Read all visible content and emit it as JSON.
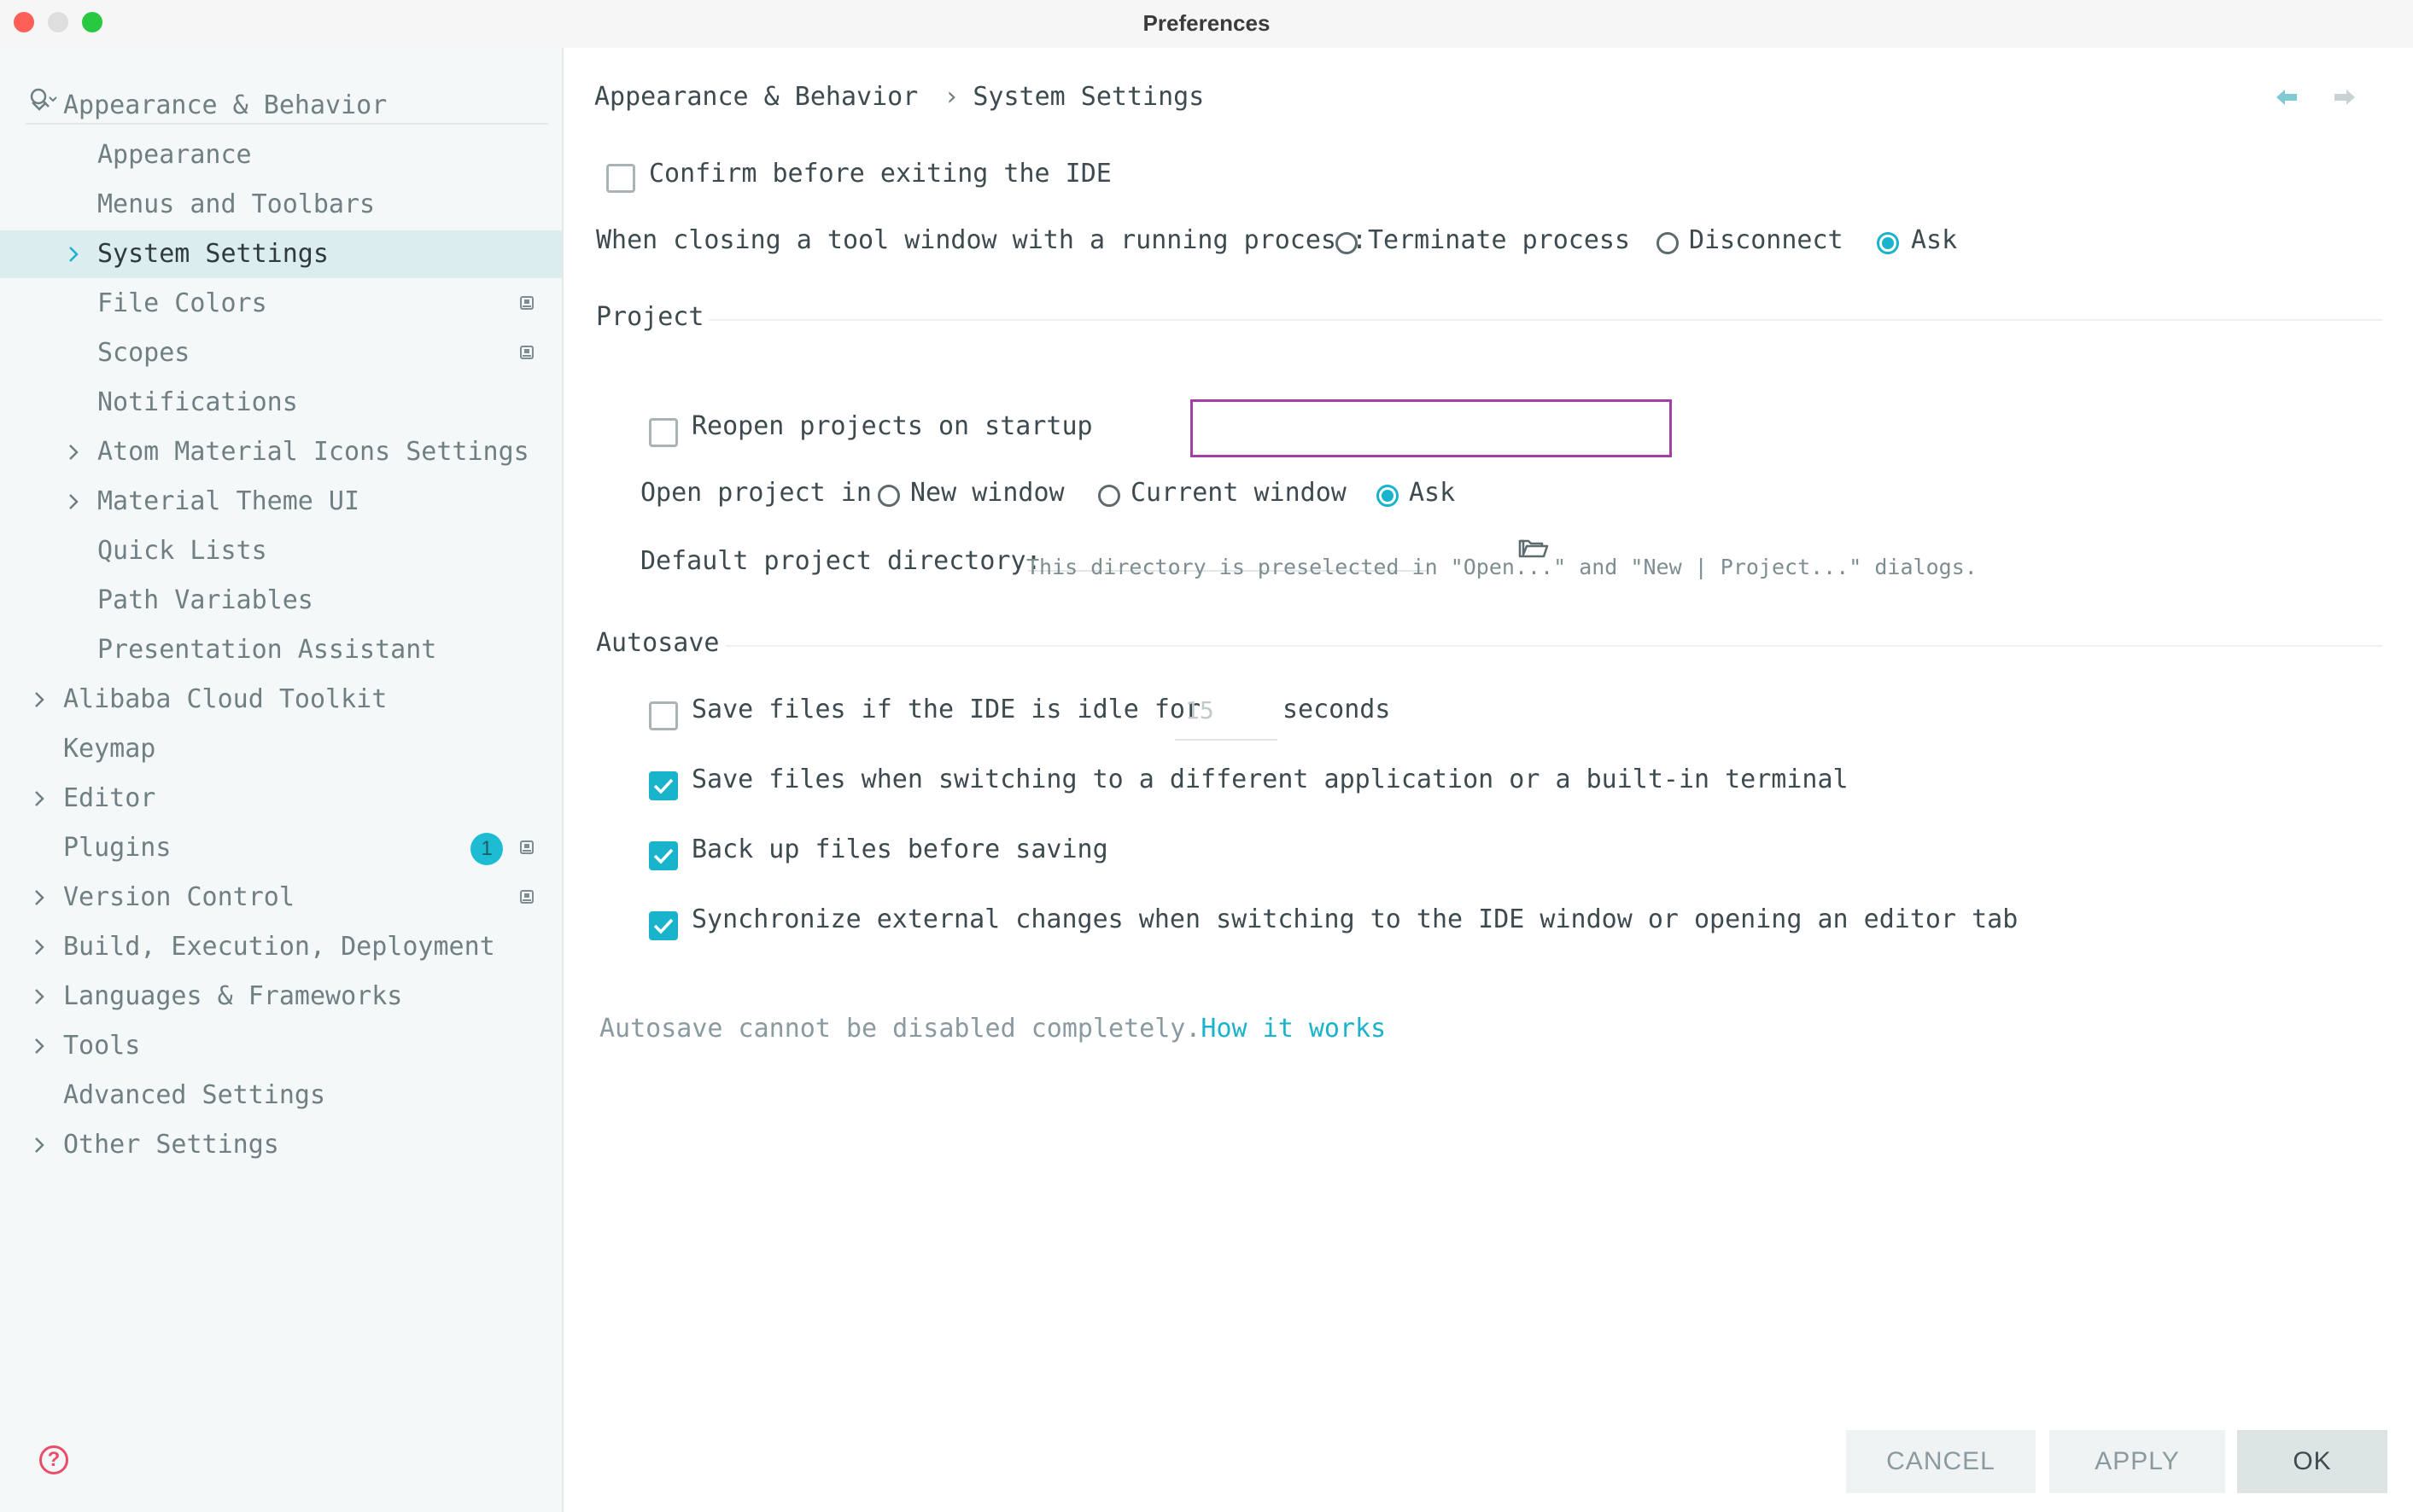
{
  "window": {
    "title": "Preferences"
  },
  "sidebar": {
    "search_placeholder": "",
    "items": [
      {
        "label": "Appearance & Behavior",
        "expandable": true,
        "expanded": true
      },
      {
        "label": "Appearance"
      },
      {
        "label": "Menus and Toolbars"
      },
      {
        "label": "System Settings",
        "expandable": true,
        "selected": true
      },
      {
        "label": "File Colors",
        "project_level": true
      },
      {
        "label": "Scopes",
        "project_level": true
      },
      {
        "label": "Notifications"
      },
      {
        "label": "Atom Material Icons Settings",
        "expandable": true
      },
      {
        "label": "Material Theme UI",
        "expandable": true
      },
      {
        "label": "Quick Lists"
      },
      {
        "label": "Path Variables"
      },
      {
        "label": "Presentation Assistant"
      },
      {
        "label": "Alibaba Cloud Toolkit",
        "expandable": true
      },
      {
        "label": "Keymap"
      },
      {
        "label": "Editor",
        "expandable": true
      },
      {
        "label": "Plugins",
        "badge": "1",
        "project_level": true
      },
      {
        "label": "Version Control",
        "expandable": true,
        "project_level": true
      },
      {
        "label": "Build, Execution, Deployment",
        "expandable": true
      },
      {
        "label": "Languages & Frameworks",
        "expandable": true
      },
      {
        "label": "Tools",
        "expandable": true
      },
      {
        "label": "Advanced Settings"
      },
      {
        "label": "Other Settings",
        "expandable": true
      }
    ]
  },
  "breadcrumb": {
    "parent": "Appearance & Behavior",
    "separator": "›",
    "current": "System Settings"
  },
  "general": {
    "confirm_exit": {
      "label": "Confirm before exiting the IDE",
      "checked": false
    },
    "closing_tool_window": {
      "label": "When closing a tool window with a running process:",
      "options": [
        "Terminate process",
        "Disconnect",
        "Ask"
      ],
      "selected": "Ask"
    }
  },
  "project": {
    "heading": "Project",
    "reopen": {
      "label": "Reopen projects on startup",
      "checked": false
    },
    "open_in": {
      "label": "Open project in",
      "options": [
        "New window",
        "Current window",
        "Ask"
      ],
      "selected": "Ask"
    },
    "default_dir": {
      "label": "Default project directory:",
      "value": "",
      "hint": "This directory is preselected in \"Open...\" and \"New | Project...\" dialogs."
    }
  },
  "autosave": {
    "heading": "Autosave",
    "idle": {
      "label": "Save files if the IDE is idle for",
      "value": "15",
      "unit": "seconds",
      "checked": false
    },
    "switching": {
      "label": "Save files when switching to a different application or a built-in terminal",
      "checked": true
    },
    "backup": {
      "label": "Back up files before saving",
      "checked": true
    },
    "sync": {
      "label": "Synchronize external changes when switching to the IDE window or opening an editor tab",
      "checked": true
    },
    "note": "Autosave cannot be disabled completely.",
    "note_link": "How it works"
  },
  "buttons": {
    "cancel": "CANCEL",
    "apply": "APPLY",
    "ok": "OK"
  },
  "colors": {
    "accent": "#1ab3cc",
    "selection": "#dbedee",
    "highlight_border": "#a43fa6"
  }
}
